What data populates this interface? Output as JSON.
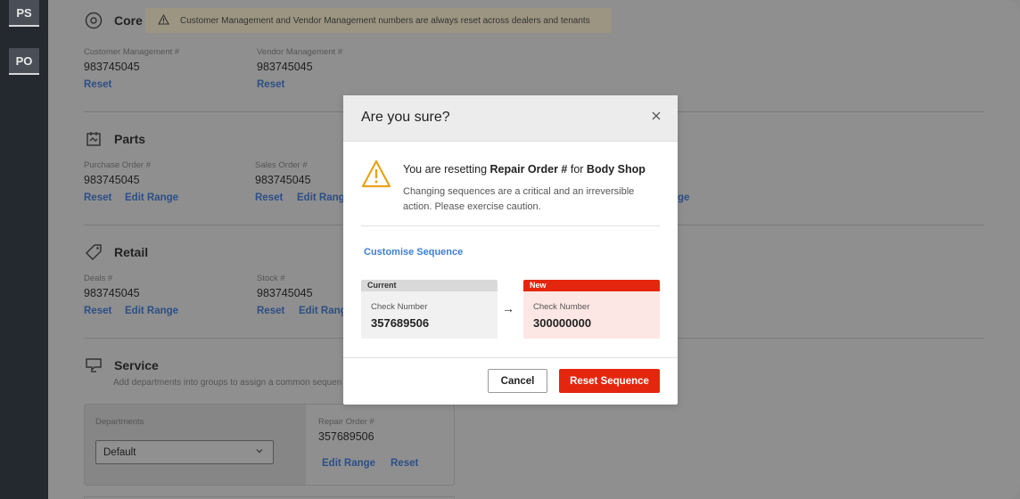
{
  "rail": {
    "items": [
      "PS",
      "PO"
    ]
  },
  "core": {
    "title": "Core",
    "banner": "Customer Management and Vendor Management numbers are always reset across dealers and tenants",
    "fields": [
      {
        "label": "Customer Management #",
        "value": "983745045",
        "reset": "Reset"
      },
      {
        "label": "Vendor Management #",
        "value": "983745045",
        "reset": "Reset"
      }
    ]
  },
  "parts": {
    "title": "Parts",
    "fields": [
      {
        "label": "Purchase Order #",
        "value": "983745045",
        "reset": "Reset",
        "edit": "Edit Range"
      },
      {
        "label": "Sales Order #",
        "value": "983745045",
        "reset": "Reset",
        "edit": "Edit Range"
      }
    ],
    "hidden_link_tail": "ge"
  },
  "retail": {
    "title": "Retail",
    "fields": [
      {
        "label": "Deals #",
        "value": "983745045",
        "reset": "Reset",
        "edit": "Edit Range"
      },
      {
        "label": "Stock #",
        "value": "983745045",
        "reset": "Reset",
        "edit": "Edit Range"
      }
    ]
  },
  "service": {
    "title": "Service",
    "subtitle": "Add departments into groups to assign a common sequen",
    "departments_label": "Departments",
    "departments_value": "Default",
    "repair_label": "Repair Order #",
    "repair_value": "357689506",
    "edit": "Edit Range",
    "reset": "Reset"
  },
  "modal": {
    "title": "Are you sure?",
    "close_icon": "close-icon",
    "msg_prefix": "You are resetting ",
    "msg_field": "Repair Order #",
    "msg_mid": " for ",
    "msg_dept": "Body Shop",
    "sub": "Changing sequences are a critical and an irreversible action. Please exercise caution.",
    "customise": "Customise Sequence",
    "current": {
      "tag": "Current",
      "label": "Check Number",
      "value": "357689506"
    },
    "new": {
      "tag": "New",
      "label": "Check Number",
      "value": "300000000"
    },
    "arrow": "→",
    "cancel": "Cancel",
    "reset": "Reset Sequence"
  },
  "colors": {
    "accent_red": "#e5260e",
    "link_blue": "#3d7fd4",
    "warning": "#e8a317"
  }
}
